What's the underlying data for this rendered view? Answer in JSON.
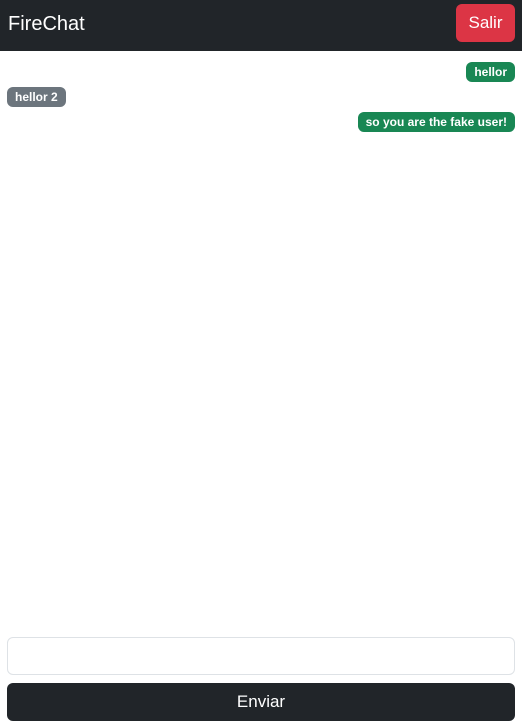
{
  "navbar": {
    "brand": "FireChat",
    "logout_label": "Salir",
    "logout_color": "#dc3545",
    "background": "#212529"
  },
  "messages": [
    {
      "text": "hellor",
      "sender": "mine",
      "color": "#198754"
    },
    {
      "text": "hellor 2",
      "sender": "theirs",
      "color": "#6c757d"
    },
    {
      "text": "so you are the fake user!",
      "sender": "mine",
      "color": "#198754"
    }
  ],
  "composer": {
    "input_value": "",
    "input_placeholder": "",
    "send_label": "Enviar"
  }
}
